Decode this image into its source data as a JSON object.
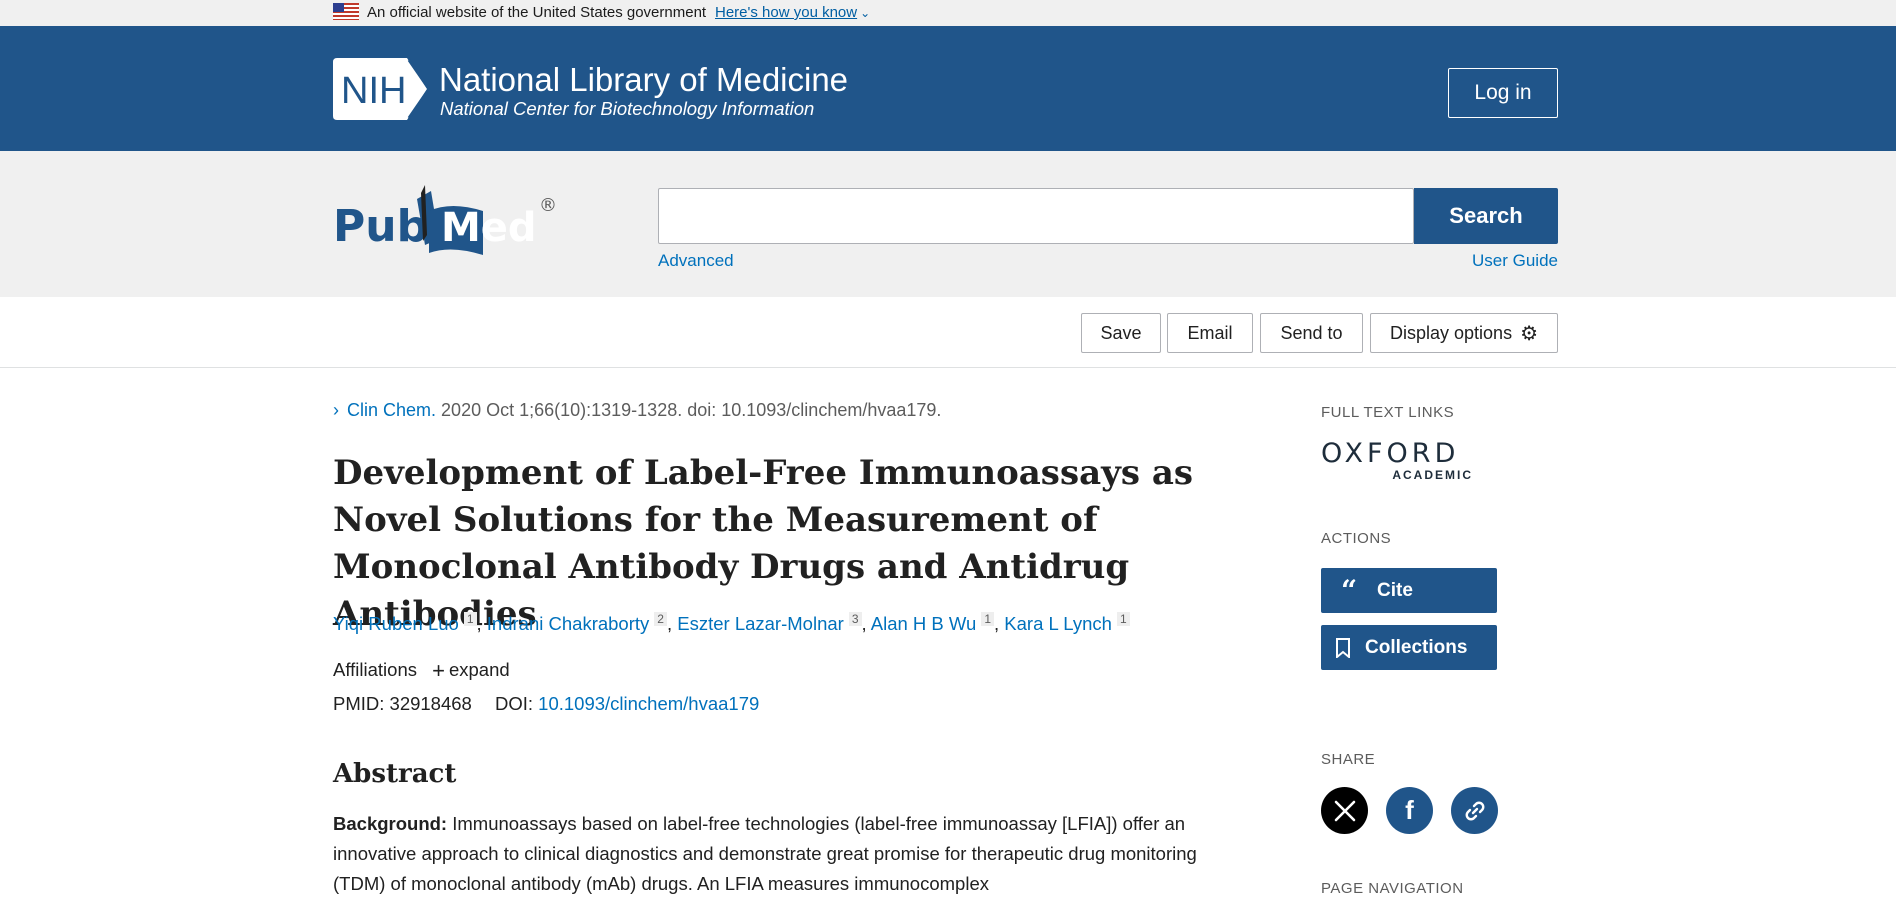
{
  "gov_banner": {
    "text": "An official website of the United States government",
    "link": "Here's how you know"
  },
  "nih_header": {
    "logo_text": "NIH",
    "title": "National Library of Medicine",
    "subtitle": "National Center for Biotechnology Information",
    "login": "Log in"
  },
  "search": {
    "logo_text_left": "Pub",
    "logo_text_right": "Med",
    "logo_reg": "®",
    "placeholder": "",
    "button": "Search",
    "advanced": "Advanced",
    "user_guide": "User Guide"
  },
  "toolbar": {
    "save": "Save",
    "email": "Email",
    "send_to": "Send to",
    "display_options": "Display options"
  },
  "article": {
    "journal": "Clin Chem.",
    "citation": "2020 Oct 1;66(10):1319-1328. doi: 10.1093/clinchem/hvaa179.",
    "title": "Development of Label-Free Immunoassays as Novel Solutions for the Measurement of Monoclonal Antibody Drugs and Antidrug Antibodies",
    "authors": [
      {
        "name": "Yiqi Ruben Luo",
        "aff": "1"
      },
      {
        "name": "Indrani Chakraborty",
        "aff": "2"
      },
      {
        "name": "Eszter Lazar-Molnar",
        "aff": "3"
      },
      {
        "name": "Alan H B Wu",
        "aff": "1"
      },
      {
        "name": "Kara L Lynch",
        "aff": "1"
      }
    ],
    "affiliations_label": "Affiliations",
    "expand_label": "expand",
    "pmid_label": "PMID:",
    "pmid": "32918468",
    "doi_label": "DOI:",
    "doi": "10.1093/clinchem/hvaa179",
    "abstract_heading": "Abstract",
    "abstract_bg_label": "Background:",
    "abstract_text": "Immunoassays based on label-free technologies (label-free immunoassay [LFIA]) offer an innovative approach to clinical diagnostics and demonstrate great promise for therapeutic drug monitoring (TDM) of monoclonal antibody (mAb) drugs. An LFIA measures immunocomplex"
  },
  "sidebar": {
    "full_text_links": "FULL TEXT LINKS",
    "oxford": "OXFORD",
    "academic": "ACADEMIC",
    "actions": "ACTIONS",
    "cite": "Cite",
    "collections": "Collections",
    "share": "SHARE",
    "page_navigation": "PAGE NAVIGATION"
  },
  "colors": {
    "nih_blue": "#20558a",
    "link_blue": "#0071bc",
    "banner_gray": "#f0f0f0"
  },
  "icons": [
    "us-flag-icon",
    "chevron-down-icon",
    "nih-logo",
    "pubmed-logo",
    "gear-icon",
    "chevron-right-icon",
    "plus-icon",
    "quote-icon",
    "bookmark-icon",
    "x-twitter-icon",
    "facebook-icon",
    "link-icon"
  ]
}
